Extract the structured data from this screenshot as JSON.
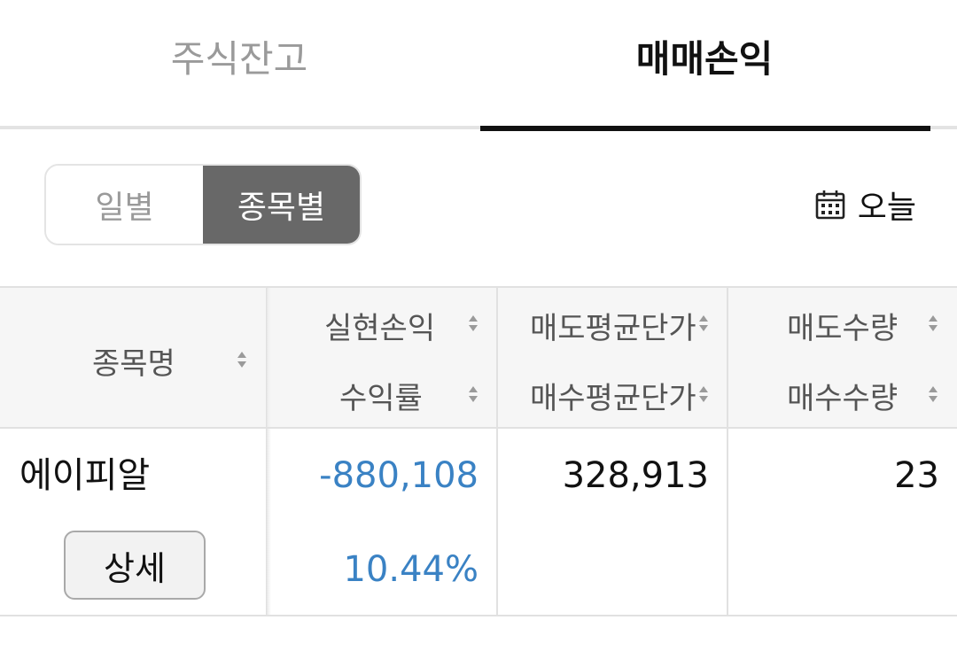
{
  "tabs": {
    "stock_balance": "주식잔고",
    "trade_pnl": "매매손익"
  },
  "segment": {
    "daily": "일별",
    "by_item": "종목별"
  },
  "date_filter": {
    "label": "오늘",
    "icon": "calendar-icon"
  },
  "table": {
    "headers": {
      "name": "종목명",
      "realized_pnl": "실현손익",
      "return_rate": "수익률",
      "avg_sell_price": "매도평균단가",
      "avg_buy_price": "매수평균단가",
      "sell_qty": "매도수량",
      "buy_qty": "매수수량"
    },
    "rows": [
      {
        "name": "에이피알",
        "detail_label": "상세",
        "realized_pnl": "-880,108",
        "return_rate": "10.44%",
        "avg_sell_price": "328,913",
        "avg_buy_price": "",
        "sell_qty": "23",
        "buy_qty": ""
      }
    ]
  },
  "colors": {
    "accent_active_tab": "#111111",
    "segment_selected_bg": "#686868",
    "value_blue": "#3a82c4",
    "header_bg": "#f6f6f6"
  }
}
